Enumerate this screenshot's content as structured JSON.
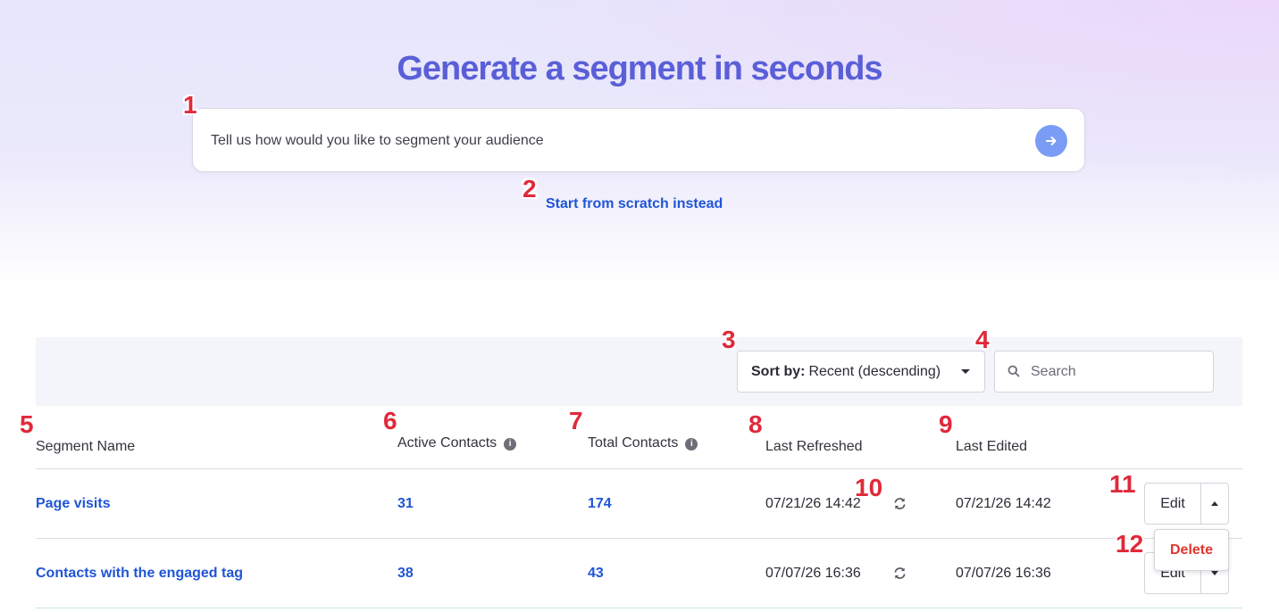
{
  "hero": {
    "title": "Generate a segment in seconds",
    "prompt_placeholder": "Tell us how would you like to segment your audience",
    "scratch_link": "Start from scratch instead"
  },
  "toolbar": {
    "sort_label": "Sort by:",
    "sort_value": "Recent (descending)",
    "search_placeholder": "Search"
  },
  "table": {
    "headers": {
      "name": "Segment Name",
      "active": "Active Contacts",
      "total": "Total Contacts",
      "refreshed": "Last Refreshed",
      "edited": "Last Edited"
    },
    "rows": [
      {
        "name": "Page visits",
        "active": "31",
        "total": "174",
        "refreshed": "07/21/26 14:42",
        "edited": "07/21/26 14:42",
        "action": "Edit"
      },
      {
        "name": "Contacts with the engaged tag",
        "active": "38",
        "total": "43",
        "refreshed": "07/07/26 16:36",
        "edited": "07/07/26 16:36",
        "action": "Edit"
      }
    ]
  },
  "dropdown_menu": {
    "delete_label": "Delete"
  },
  "markers": [
    "1",
    "2",
    "3",
    "4",
    "5",
    "6",
    "7",
    "8",
    "9",
    "10",
    "11",
    "12"
  ],
  "colors": {
    "accent": "#5a5fd8",
    "link": "#1f55d6",
    "danger": "#e0362c",
    "marker": "#e0293a"
  }
}
